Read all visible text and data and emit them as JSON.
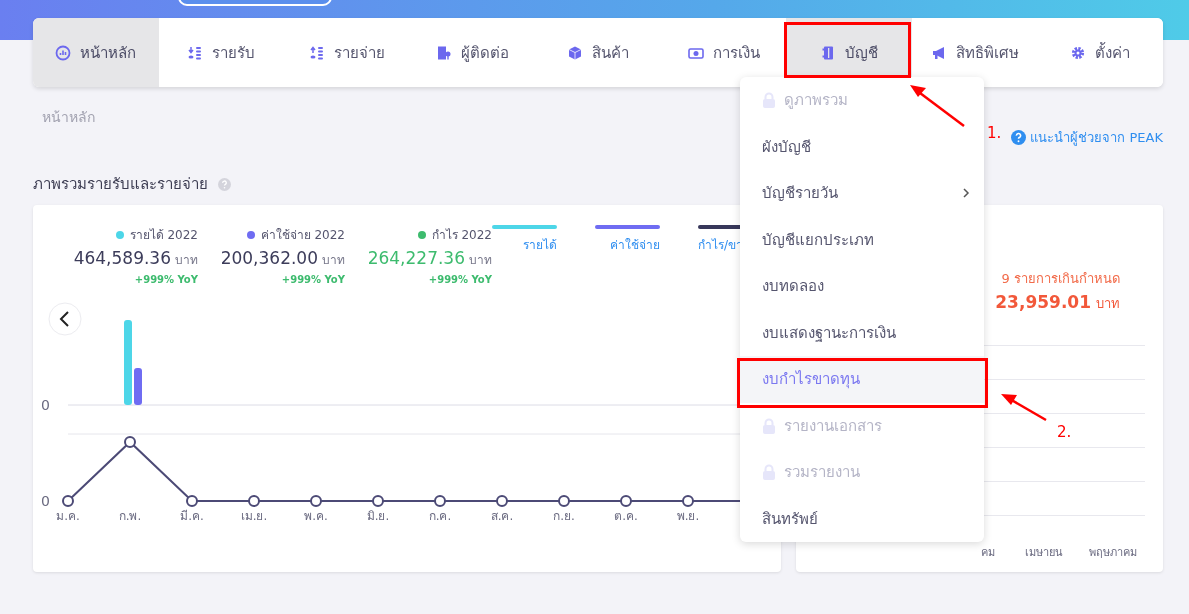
{
  "nav": [
    {
      "label": "หน้าหลัก",
      "selected": true
    },
    {
      "label": "รายรับ",
      "selected": false
    },
    {
      "label": "รายจ่าย",
      "selected": false
    },
    {
      "label": "ผู้ติดต่อ",
      "selected": false
    },
    {
      "label": "สินค้า",
      "selected": false
    },
    {
      "label": "การเงิน",
      "selected": false
    },
    {
      "label": "บัญชี",
      "selected": true
    },
    {
      "label": "สิทธิพิเศษ",
      "selected": false
    },
    {
      "label": "ตั้งค่า",
      "selected": false
    }
  ],
  "breadcrumb": "หน้าหลัก",
  "help_link": "แนะนำผู้ช่วยจาก PEAK",
  "section_title": "ภาพรวมรายรับและรายจ่าย",
  "overview": {
    "stats": [
      {
        "label": "รายได้ 2022",
        "color": "#4dd6e8",
        "amount": "464,589.36",
        "unit": "บาท",
        "change": "+999% YoY",
        "highlight": false
      },
      {
        "label": "ค่าใช้จ่าย 2022",
        "color": "#6f6cf2",
        "amount": "200,362.00",
        "unit": "บาท",
        "change": "+999% YoY",
        "highlight": false
      },
      {
        "label": "กำไร 2022",
        "color": "#3dbb6e",
        "amount": "264,227.36",
        "unit": "บาท",
        "change": "+999% YoY",
        "highlight": true
      }
    ],
    "legend": [
      {
        "label": "รายได้",
        "color": "#4dd6e8"
      },
      {
        "label": "ค่าใช้จ่าย",
        "color": "#6f6cf2"
      },
      {
        "label": "กำไร/ขา",
        "color": "#37375a"
      }
    ],
    "bar_axis_label": "0",
    "line_axis_label": "0",
    "months": [
      "ม.ค.",
      "ก.พ.",
      "มี.ค.",
      "เม.ย.",
      "พ.ค.",
      "มิ.ย.",
      "ก.ค.",
      "ส.ค.",
      "ก.ย.",
      "ต.ค.",
      "พ.ย."
    ]
  },
  "overdue": {
    "label": "9 รายการเกินกำหนด",
    "amount": "23,959.01",
    "unit": "บาท",
    "months": [
      "คม",
      "เมษายน",
      "พฤษภาคม"
    ]
  },
  "menu": [
    {
      "label": "ดูภาพรวม",
      "locked": true,
      "selected": false,
      "submenu": false
    },
    {
      "label": "ผังบัญชี",
      "locked": false,
      "selected": false,
      "submenu": false
    },
    {
      "label": "บัญชีรายวัน",
      "locked": false,
      "selected": false,
      "submenu": true
    },
    {
      "label": "บัญชีแยกประเภท",
      "locked": false,
      "selected": false,
      "submenu": false
    },
    {
      "label": "งบทดลอง",
      "locked": false,
      "selected": false,
      "submenu": false
    },
    {
      "label": "งบแสดงฐานะการเงิน",
      "locked": false,
      "selected": false,
      "submenu": false
    },
    {
      "label": "งบกำไรขาดทุน",
      "locked": false,
      "selected": true,
      "submenu": false
    },
    {
      "label": "รายงานเอกสาร",
      "locked": true,
      "selected": false,
      "submenu": false
    },
    {
      "label": "รวมรายงาน",
      "locked": true,
      "selected": false,
      "submenu": false
    },
    {
      "label": "สินทรัพย์",
      "locked": false,
      "selected": false,
      "submenu": false
    }
  ],
  "annotations": [
    {
      "label": "1."
    },
    {
      "label": "2."
    }
  ]
}
